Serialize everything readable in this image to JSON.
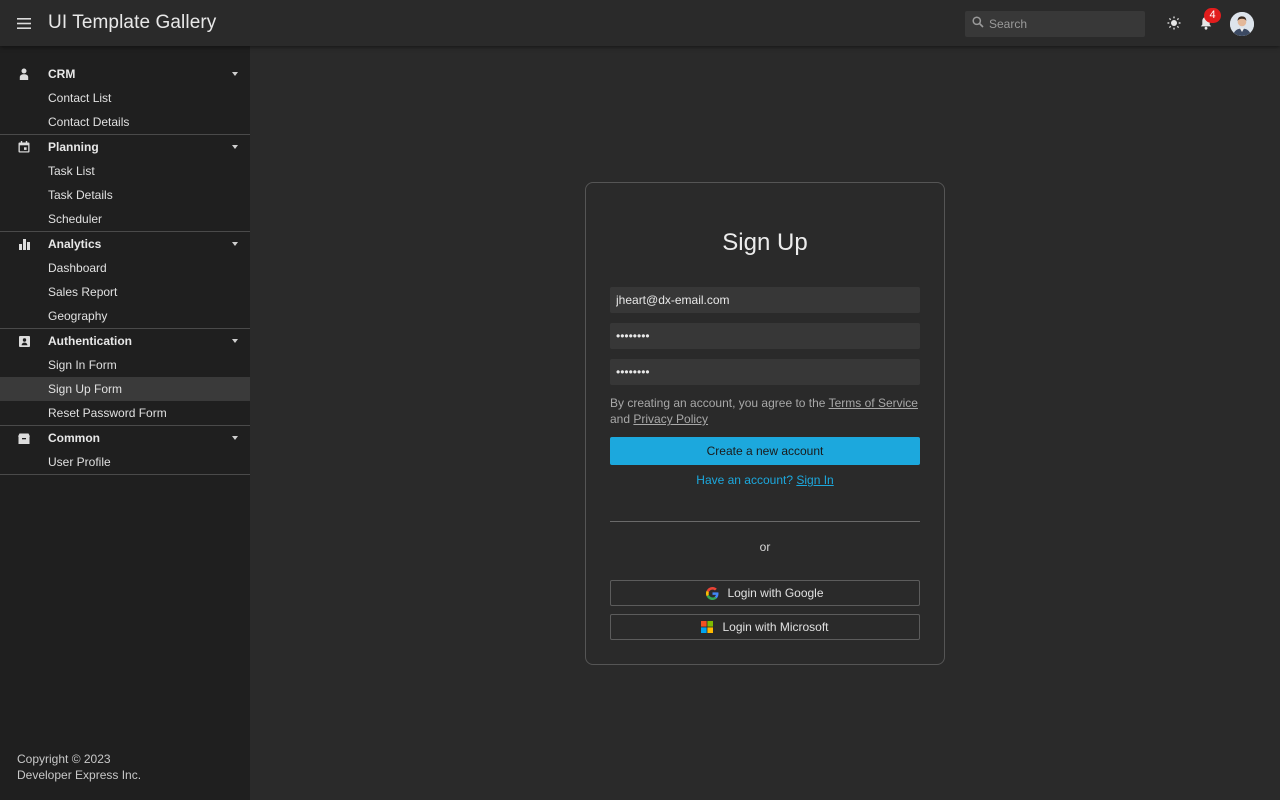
{
  "header": {
    "title": "UI Template Gallery",
    "search_placeholder": "Search",
    "notification_count": "4"
  },
  "sidebar": {
    "groups": [
      {
        "label": "CRM",
        "icon": "user-icon",
        "items": [
          "Contact List",
          "Contact Details"
        ]
      },
      {
        "label": "Planning",
        "icon": "calendar-icon",
        "items": [
          "Task List",
          "Task Details",
          "Scheduler"
        ]
      },
      {
        "label": "Analytics",
        "icon": "bar-chart-icon",
        "items": [
          "Dashboard",
          "Sales Report",
          "Geography"
        ]
      },
      {
        "label": "Authentication",
        "icon": "contact-card-icon",
        "items": [
          "Sign In Form",
          "Sign Up Form",
          "Reset Password Form"
        ]
      },
      {
        "label": "Common",
        "icon": "box-icon",
        "items": [
          "User Profile"
        ]
      }
    ],
    "selected_item": "Sign Up Form",
    "copyright_line1": "Copyright © 2023",
    "copyright_line2": "Developer Express Inc."
  },
  "signup": {
    "title": "Sign Up",
    "email_value": "jheart@dx-email.com",
    "password_value": "••••••••",
    "confirm_password_value": "••••••••",
    "terms_prefix": "By creating an account, you agree to the",
    "terms_link": "Terms of Service",
    "terms_and": "and",
    "privacy_link": "Privacy Policy",
    "create_button": "Create a new account",
    "have_account": "Have an account?",
    "sign_in_link": "Sign In",
    "or_text": "or",
    "google_button": "Login with Google",
    "microsoft_button": "Login with Microsoft"
  },
  "colors": {
    "accent": "#1ca8dd",
    "badge": "#e21d1d",
    "sidebar_bg": "#1f1f1f",
    "content_bg": "#2a2a2a"
  }
}
